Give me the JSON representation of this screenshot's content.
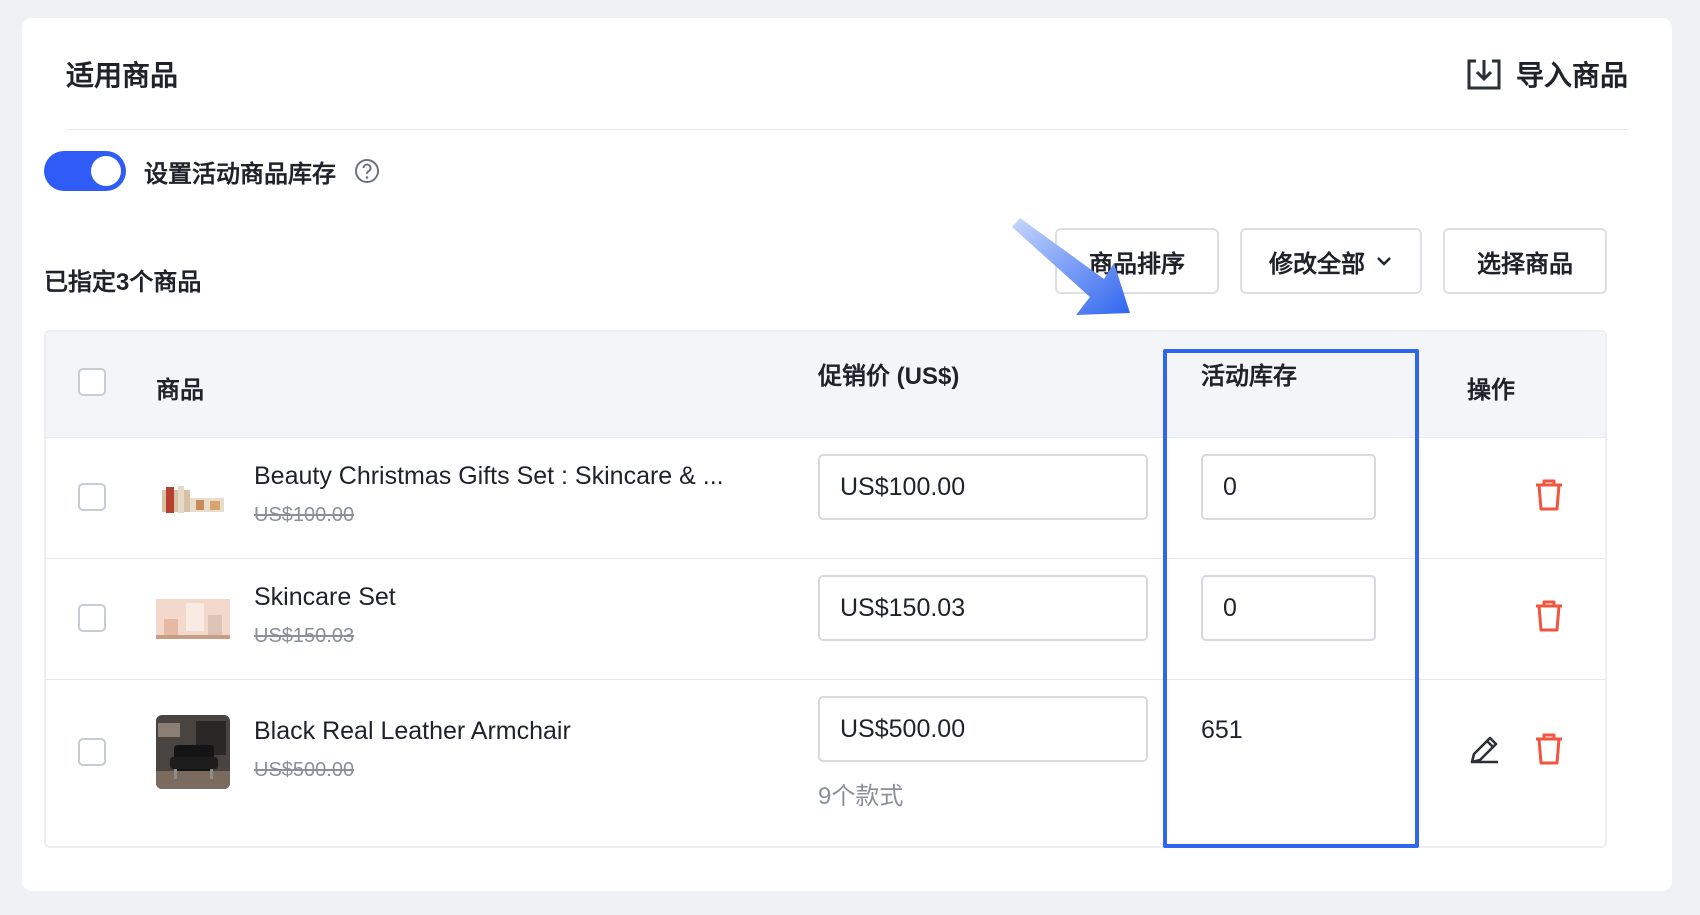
{
  "header": {
    "title": "适用商品",
    "import_label": "导入商品"
  },
  "stock_toggle": {
    "label": "设置活动商品库存",
    "enabled": true
  },
  "toolbar": {
    "count_text": "已指定3个商品",
    "sort_label": "商品排序",
    "edit_all_label": "修改全部",
    "select_label": "选择商品"
  },
  "table": {
    "columns": {
      "product": "商品",
      "price": "促销价 (US$)",
      "stock": "活动库存",
      "actions": "操作"
    },
    "rows": [
      {
        "name": "Beauty Christmas Gifts Set : Skincare & ...",
        "original_price": "US$100.00",
        "promo_price": "US$100.00",
        "stock": "0"
      },
      {
        "name": "Skincare Set",
        "original_price": "US$150.03",
        "promo_price": "US$150.03",
        "stock": "0"
      },
      {
        "name": "Black Real Leather Armchair",
        "original_price": "US$500.00",
        "promo_price": "US$500.00",
        "stock": "651",
        "variants": "9个款式"
      }
    ]
  },
  "colors": {
    "accent": "#2f5cf6",
    "highlight": "#2f66f0",
    "danger": "#f0553f"
  }
}
